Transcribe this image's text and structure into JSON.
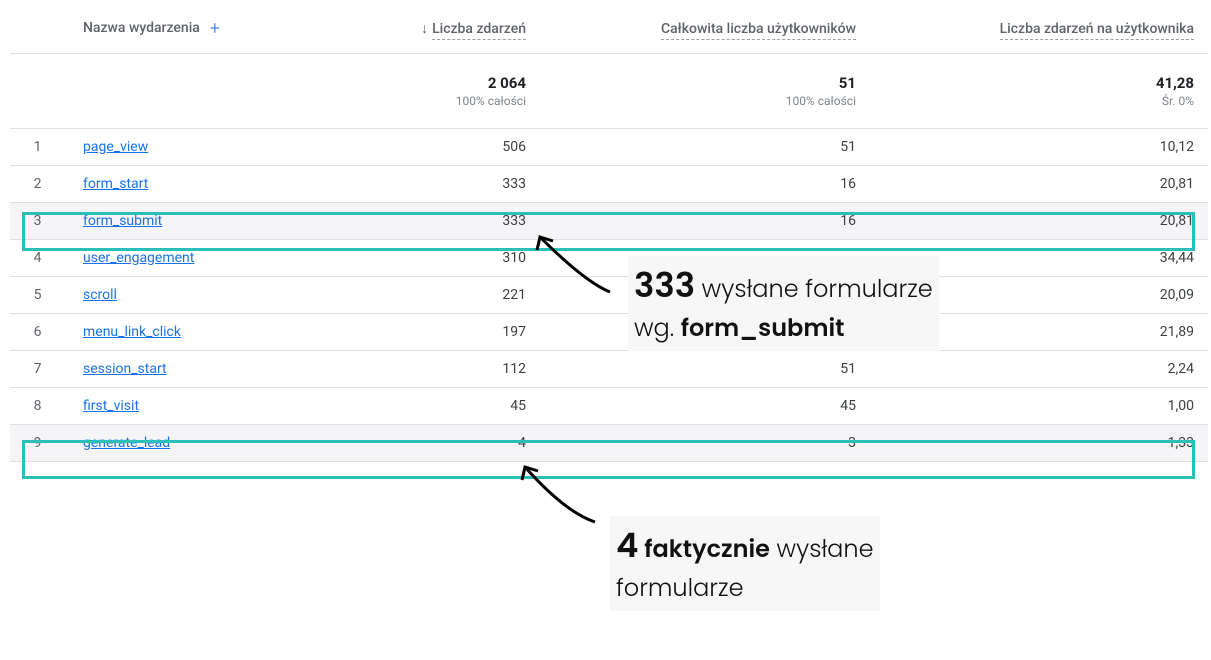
{
  "headers": {
    "name": "Nazwa wydarzenia",
    "events": "Liczba zdarzeń",
    "users": "Całkowita liczba użytkowników",
    "per_user": "Liczba zdarzeń na użytkownika"
  },
  "totals": {
    "events": "2 064",
    "events_sub": "100% całości",
    "users": "51",
    "users_sub": "100% całości",
    "per_user": "41,28",
    "per_user_sub": "Śr. 0%"
  },
  "rows": [
    {
      "idx": "1",
      "name": "page_view",
      "events": "506",
      "users": "51",
      "per": "10,12",
      "shade": false
    },
    {
      "idx": "2",
      "name": "form_start",
      "events": "333",
      "users": "16",
      "per": "20,81",
      "shade": false
    },
    {
      "idx": "3",
      "name": "form_submit",
      "events": "333",
      "users": "16",
      "per": "20,81",
      "shade": true
    },
    {
      "idx": "4",
      "name": "user_engagement",
      "events": "310",
      "users": "",
      "per": "34,44",
      "shade": false
    },
    {
      "idx": "5",
      "name": "scroll",
      "events": "221",
      "users": "",
      "per": "20,09",
      "shade": false
    },
    {
      "idx": "6",
      "name": "menu_link_click",
      "events": "197",
      "users": "",
      "per": "21,89",
      "shade": false
    },
    {
      "idx": "7",
      "name": "session_start",
      "events": "112",
      "users": "51",
      "per": "2,24",
      "shade": false
    },
    {
      "idx": "8",
      "name": "first_visit",
      "events": "45",
      "users": "45",
      "per": "1,00",
      "shade": false
    },
    {
      "idx": "9",
      "name": "generate_lead",
      "events": "4",
      "users": "3",
      "per": "1,33",
      "shade": true
    }
  ],
  "annotation1": {
    "big": "333",
    "line1_rest": " wysłane formularze",
    "line2_pre": "wg. ",
    "line2_bold": "form_submit"
  },
  "annotation2": {
    "big": "4",
    "line1_bold_rest": " faktycznie",
    "line1_rest": " wysłane",
    "line2": "formularze"
  }
}
